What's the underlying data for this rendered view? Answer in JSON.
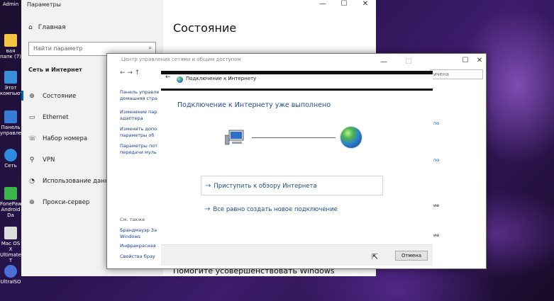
{
  "desktop": {
    "icons": [
      {
        "label": "Admin",
        "color": "#e0e0e0"
      },
      {
        "label": "вая папк (7)",
        "color": "#f4c542"
      },
      {
        "label": "Этот компьютер",
        "color": "#3a8fd9"
      },
      {
        "label": "Панель управлени",
        "color": "#3a7bd5"
      },
      {
        "label": "Сеть",
        "color": "#2f8be0"
      },
      {
        "label": "FonePaw Android Da",
        "color": "#3cb44b"
      },
      {
        "label": "Mac OS X Ultimate T",
        "color": "#dddddd"
      },
      {
        "label": "UltraISO",
        "color": "#4a6fd8"
      }
    ]
  },
  "settings": {
    "window_title": "Параметры",
    "home": "Главная",
    "search_placeholder": "Найти параметр",
    "section": "Сеть и Интернет",
    "nav": [
      {
        "label": "Состояние",
        "icon": "globe-icon"
      },
      {
        "label": "Ethernet",
        "icon": "monitor-icon"
      },
      {
        "label": "Набор номера",
        "icon": "phone-icon"
      },
      {
        "label": "VPN",
        "icon": "vpn-icon"
      },
      {
        "label": "Использование данны",
        "icon": "data-usage-icon"
      },
      {
        "label": "Прокси-сервер",
        "icon": "globe-icon"
      }
    ],
    "main_title": "Состояние",
    "bottom_text": "Помогите усовершенствовать Windows"
  },
  "netcenter": {
    "title": "Центр управления сетями и общим доступом",
    "search_fragment": "ичена",
    "left_links": [
      "Панель управле домашняя стра",
      "Изменение пар адаптера",
      "Изменить допо параметры об",
      "Параметры пот передачи муль"
    ],
    "see_also": "См. также",
    "see_also_links": [
      "Брандмауэр Зa Windows",
      "Инфракрасная",
      "Свойства брау"
    ],
    "right_fragments": [
      "по",
      "по",
      "ие",
      "ие"
    ]
  },
  "dialog": {
    "title": "Подключение к Интернету",
    "heading": "Подключение к Интернету уже выполнено",
    "option_browse": "Приступить к обзору Интернета",
    "option_new": "Все равно создать новое подключение",
    "cancel": "Отмена"
  }
}
